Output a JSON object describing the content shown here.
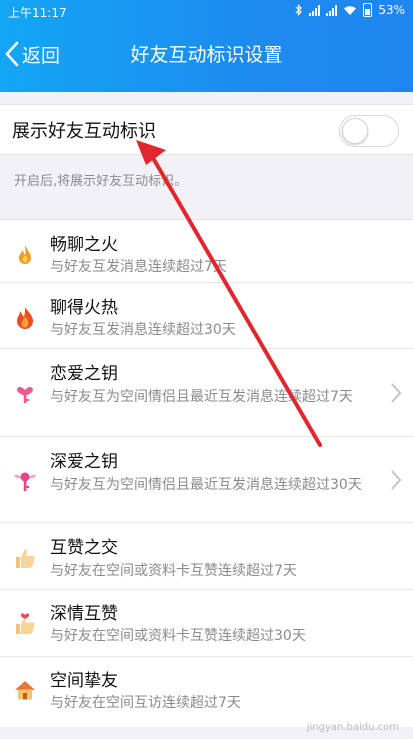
{
  "status": {
    "time": "上午11:17",
    "battery": "53%"
  },
  "nav": {
    "back_label": "返回",
    "title": "好友互动标识设置"
  },
  "toggle": {
    "label": "展示好友互动标识",
    "on": false
  },
  "hint": "开启后,将展示好友互动标识。",
  "items": [
    {
      "title": "畅聊之火",
      "desc": "与好友互发消息连续超过7天",
      "icon": "flame-icon"
    },
    {
      "title": "聊得火热",
      "desc": "与好友互发消息连续超过30天",
      "icon": "big-flame-icon"
    },
    {
      "title": "恋爱之钥",
      "desc": "与好友互为空间情侣且最近互发消息连续超过7天",
      "icon": "pink-key-icon"
    },
    {
      "title": "深爱之钥",
      "desc": "与好友互为空间情侣且最近互发消息连续超过30天",
      "icon": "winged-key-icon"
    },
    {
      "title": "互赞之交",
      "desc": "与好友在空间或资料卡互赞连续超过7天",
      "icon": "thumbs-up-icon"
    },
    {
      "title": "深情互赞",
      "desc": "与好友在空间或资料卡互赞连续超过30天",
      "icon": "heart-thumbs-up-icon"
    },
    {
      "title": "空间挚友",
      "desc": "与好友在空间互访连续超过7天",
      "icon": "house-icon"
    }
  ],
  "watermark": "jingyan.baidu.com",
  "colors": {
    "header": "#1d8bf0",
    "arrow": "#e3262d"
  }
}
